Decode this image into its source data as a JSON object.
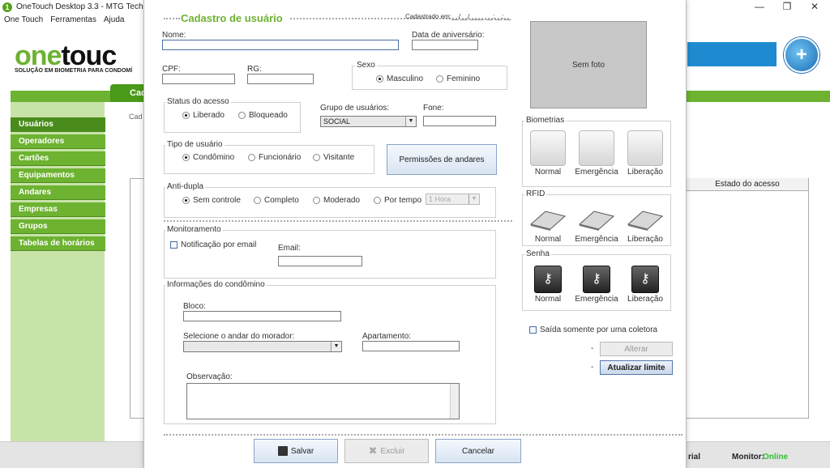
{
  "window": {
    "title": "OneTouch Desktop 3.3 - MTG Tech",
    "logo_char": "1",
    "minimize": "—",
    "restore": "❐",
    "close": "✕"
  },
  "menu": [
    "One Touch",
    "Ferramentas",
    "Ajuda"
  ],
  "banner": {
    "brand_one": "one",
    "brand_touch": "touc",
    "tagline": "SOLUÇÃO EM BIOMETRIA PARA CONDOMÍ",
    "globe_char": "+"
  },
  "nav_tab": "Cad",
  "sidebar": {
    "items": [
      {
        "label": "Usuários",
        "active": true
      },
      {
        "label": "Operadores"
      },
      {
        "label": "Cartões"
      },
      {
        "label": "Equipamentos"
      },
      {
        "label": "Andares"
      },
      {
        "label": "Empresas"
      },
      {
        "label": "Grupos"
      },
      {
        "label": "Tabelas de horários"
      }
    ]
  },
  "background": {
    "cad_label": "Cad",
    "column_header": "Estado do acesso",
    "status_partial": "rial",
    "monitor_label": "Monitor:",
    "monitor_value": "Online",
    "monitor_color": "#35c035"
  },
  "dialog": {
    "title": "Cadastro de usuário",
    "registered_label": "Cadastrado em:",
    "registered_value": "__/__/____ __:__:__",
    "fields": {
      "name_label": "Nome:",
      "birthday_label": "Data de aniversário:",
      "cpf_label": "CPF:",
      "rg_label": "RG:",
      "group_label": "Grupo de usuários:",
      "group_value": "SOCIAL",
      "phone_label": "Fone:",
      "email_label": "Email:",
      "block_label": "Bloco:",
      "floor_label": "Selecione o andar do morador:",
      "apartment_label": "Apartamento:",
      "notes_label": "Observação:"
    },
    "sexo": {
      "title": "Sexo",
      "options": [
        "Masculino",
        "Feminino"
      ],
      "selected": "Masculino"
    },
    "status_acesso": {
      "title": "Status do acesso",
      "options": [
        "Liberado",
        "Bloqueado"
      ],
      "selected": "Liberado"
    },
    "tipo_usuario": {
      "title": "Tipo de usuário",
      "options": [
        "Condômino",
        "Funcionário",
        "Visitante"
      ],
      "selected": "Condômino"
    },
    "permissions_button": "Permissões de andares",
    "anti_dupla": {
      "title": "Anti-dupla",
      "options": [
        "Sem controle",
        "Completo",
        "Moderado",
        "Por tempo"
      ],
      "selected": "Sem controle",
      "time_value": "1 Hora"
    },
    "monitoramento": {
      "title": "Monitoramento",
      "email_notification": "Notificação por email"
    },
    "condominio": {
      "title": "Informações do condômino"
    },
    "photo_text": "Sem foto",
    "biometrias": {
      "title": "Biometrias",
      "items": [
        "Normal",
        "Emergência",
        "Liberação"
      ]
    },
    "rfid": {
      "title": "RFID",
      "items": [
        "Normal",
        "Emergência",
        "Liberação"
      ]
    },
    "senha": {
      "title": "Senha",
      "items": [
        "Normal",
        "Emergência",
        "Liberação"
      ]
    },
    "single_reader": "Saída somente por uma coletora",
    "dash1": "-",
    "dash2": "-",
    "alterar_button": "Alterar",
    "atualizar_button": "Atualizar limite",
    "save_button": "Salvar",
    "delete_button": "Excluir",
    "cancel_button": "Cancelar"
  }
}
